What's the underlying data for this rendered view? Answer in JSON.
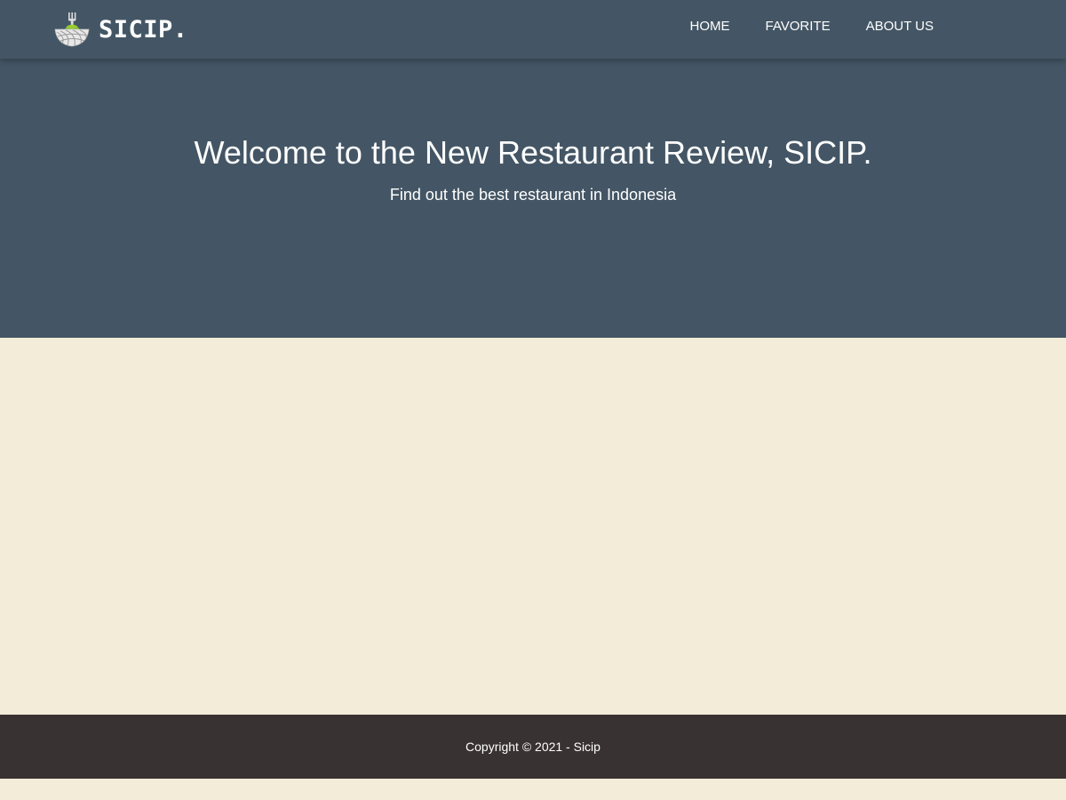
{
  "header": {
    "brand_name": "SICIP.",
    "logo_icon": "bowl-fork-icon",
    "nav": [
      {
        "label": "HOME"
      },
      {
        "label": "FAVORITE"
      },
      {
        "label": "ABOUT US"
      }
    ]
  },
  "hero": {
    "title": "Welcome to the New Restaurant Review, SICIP.",
    "subtitle": "Find out the best restaurant in Indonesia"
  },
  "footer": {
    "copyright": "Copyright © 2021 - Sicip"
  },
  "colors": {
    "header_bg": "#445665",
    "page_bg": "#f2ecd8",
    "footer_bg": "#393232",
    "logo_accent": "#9acd32"
  }
}
